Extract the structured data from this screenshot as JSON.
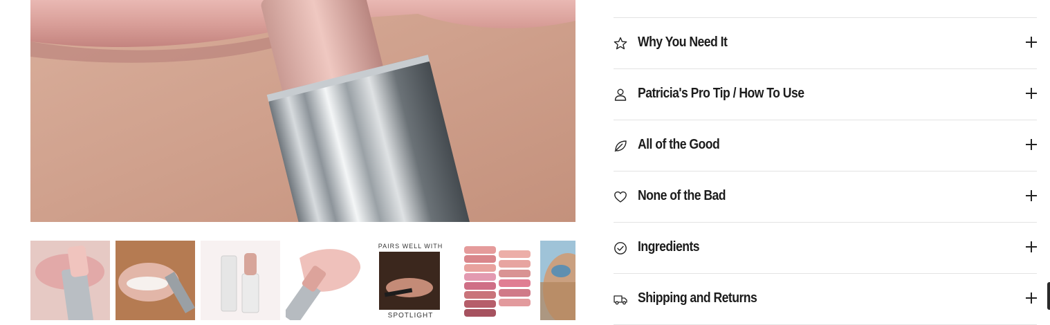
{
  "gallery": {
    "main_image": "lipstick-closeup-image",
    "thumbnails": [
      {
        "name": "thumb-lips-closeup"
      },
      {
        "name": "thumb-smile-lipstick"
      },
      {
        "name": "thumb-lipstick-product"
      },
      {
        "name": "thumb-lipstick-swatch"
      },
      {
        "name": "thumb-pairs-well-with",
        "caption_top": "PAIRS WELL WITH",
        "caption_bottom": "SPOTLIGHT"
      },
      {
        "name": "thumb-shade-swatches"
      },
      {
        "name": "thumb-model-sunglasses"
      }
    ]
  },
  "accordion": {
    "items": [
      {
        "label": "Why You Need It",
        "icon": "star-icon"
      },
      {
        "label": "Patricia's Pro Tip / How To Use",
        "icon": "person-icon"
      },
      {
        "label": "All of the Good",
        "icon": "leaf-icon"
      },
      {
        "label": "None of the Bad",
        "icon": "heart-icon"
      },
      {
        "label": "Ingredients",
        "icon": "check-circle-icon"
      },
      {
        "label": "Shipping and Returns",
        "icon": "truck-icon"
      }
    ],
    "expand_icon": "plus-icon"
  }
}
